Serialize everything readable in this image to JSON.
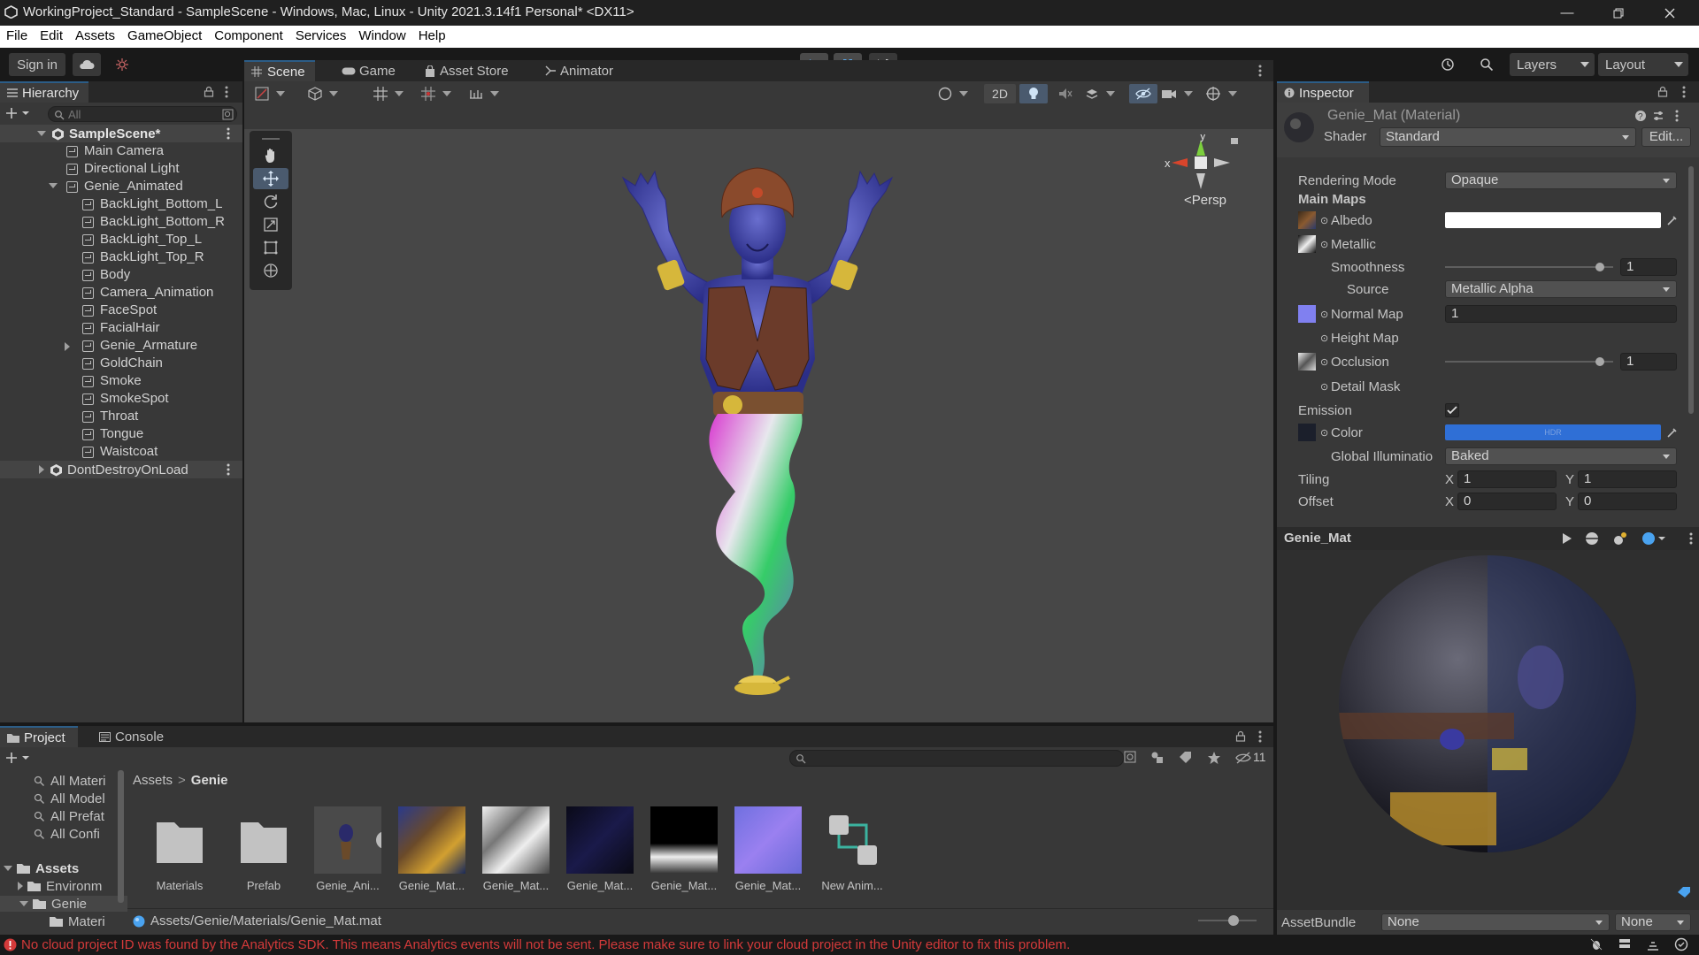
{
  "window": {
    "title": "WorkingProject_Standard - SampleScene - Windows, Mac, Linux - Unity 2021.3.14f1 Personal* <DX11>"
  },
  "menu": [
    "File",
    "Edit",
    "Assets",
    "GameObject",
    "Component",
    "Services",
    "Window",
    "Help"
  ],
  "toolbar": {
    "sign_in": "Sign in",
    "layers": "Layers",
    "layout": "Layout"
  },
  "hierarchy": {
    "tab": "Hierarchy",
    "search_placeholder": "All",
    "scene": "SampleScene*",
    "items": [
      "Main Camera",
      "Directional Light",
      "Genie_Animated",
      "BackLight_Bottom_L",
      "BackLight_Bottom_R",
      "BackLight_Top_L",
      "BackLight_Top_R",
      "Body",
      "Camera_Animation",
      "FaceSpot",
      "FacialHair",
      "Genie_Armature",
      "GoldChain",
      "Smoke",
      "SmokeSpot",
      "Throat",
      "Tongue",
      "Waistcoat"
    ],
    "dont_destroy": "DontDestroyOnLoad"
  },
  "scene_tabs": [
    "Scene",
    "Game",
    "Asset Store",
    "Animator"
  ],
  "scene": {
    "btn_2d": "2D",
    "persp": "<Persp",
    "axis_x": "x",
    "axis_y": "y"
  },
  "inspector": {
    "tab": "Inspector",
    "title": "Genie_Mat (Material)",
    "shader_label": "Shader",
    "shader_value": "Standard",
    "edit": "Edit...",
    "rendering_mode_label": "Rendering Mode",
    "rendering_mode": "Opaque",
    "main_maps": "Main Maps",
    "albedo": "Albedo",
    "metallic": "Metallic",
    "smoothness": "Smoothness",
    "smoothness_value": "1",
    "smoothness_level": 0.92,
    "source": "Source",
    "source_value": "Metallic Alpha",
    "normal_map": "Normal Map",
    "normal_value": "1",
    "height_map": "Height Map",
    "occlusion": "Occlusion",
    "occlusion_value": "1",
    "occlusion_level": 0.92,
    "detail_mask": "Detail Mask",
    "emission": "Emission",
    "color": "Color",
    "hdr": "HDR",
    "gi": "Global Illuminatio",
    "gi_value": "Baked",
    "tiling": "Tiling",
    "offset": "Offset",
    "x": "X",
    "y": "Y",
    "tiling_x": "1",
    "tiling_y": "1",
    "offset_x": "0",
    "offset_y": "0",
    "preview_title": "Genie_Mat",
    "assetbundle": "AssetBundle",
    "assetbundle_value": "None",
    "variant_value": "None",
    "emission_color": "#2f6fd6"
  },
  "project": {
    "tabs": [
      "Project",
      "Console"
    ],
    "favorites": [
      "All Materi",
      "All Model",
      "All Prefat",
      "All Confi"
    ],
    "tree": [
      "Assets",
      "Environm",
      "Genie",
      "Materi"
    ],
    "breadcrumb": [
      "Assets",
      "Genie"
    ],
    "hidden_count": "11",
    "assets": [
      "Materials",
      "Prefab",
      "Genie_Ani...",
      "Genie_Mat...",
      "Genie_Mat...",
      "Genie_Mat...",
      "Genie_Mat...",
      "Genie_Mat...",
      "New Anim..."
    ],
    "path": "Assets/Genie/Materials/Genie_Mat.mat"
  },
  "status": {
    "message": "No cloud project ID was found by the Analytics SDK. This means Analytics events will not be sent. Please make sure to link your cloud project in the Unity editor to fix this problem."
  }
}
